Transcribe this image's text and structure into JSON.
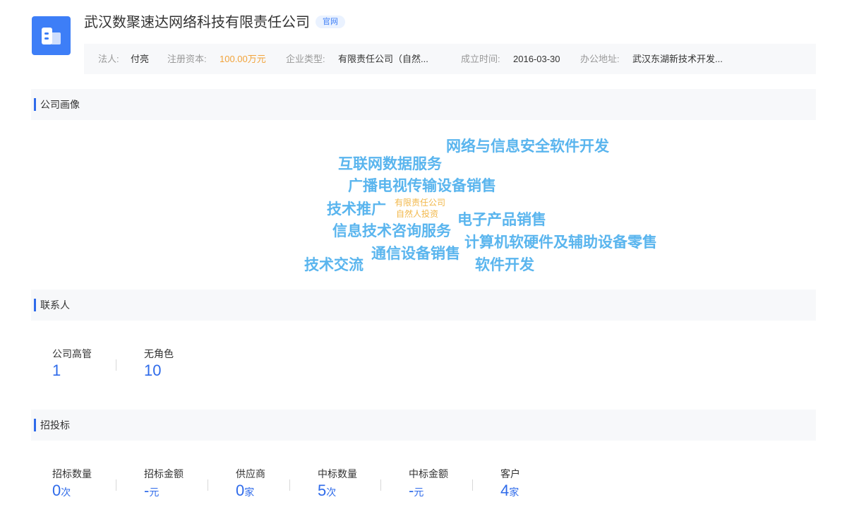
{
  "company": {
    "name": "武汉数聚速达网络科技有限责任公司",
    "badge": "官网",
    "logo_icon": "building-icon",
    "brand_color": "#3d7ef7"
  },
  "info": {
    "legal_rep_label": "法人:",
    "legal_rep": "付亮",
    "capital_label": "注册资本:",
    "capital": "100.00万元",
    "type_label": "企业类型:",
    "type": "有限责任公司（自然...",
    "founded_label": "成立时间:",
    "founded": "2016-03-30",
    "address_label": "办公地址:",
    "address": "武汉东湖新技术开发..."
  },
  "sections": {
    "profile": "公司画像",
    "contacts": "联系人",
    "bidding": "招投标"
  },
  "word_cloud": [
    "网络与信息安全软件开发",
    "互联网数据服务",
    "广播电视传输设备销售",
    "技术推广",
    "有限责任公司",
    "自然人投资",
    "电子产品销售",
    "信息技术咨询服务",
    "计算机软硬件及辅助设备零售",
    "通信设备销售",
    "技术交流",
    "软件开发"
  ],
  "contacts": [
    {
      "label": "公司高管",
      "value": "1"
    },
    {
      "label": "无角色",
      "value": "10"
    }
  ],
  "bidding": [
    {
      "label": "招标数量",
      "value": "0",
      "unit": "次"
    },
    {
      "label": "招标金额",
      "value": "-",
      "unit": "元"
    },
    {
      "label": "供应商",
      "value": "0",
      "unit": "家"
    },
    {
      "label": "中标数量",
      "value": "5",
      "unit": "次"
    },
    {
      "label": "中标金额",
      "value": "-",
      "unit": "元"
    },
    {
      "label": "客户",
      "value": "4",
      "unit": "家"
    }
  ]
}
